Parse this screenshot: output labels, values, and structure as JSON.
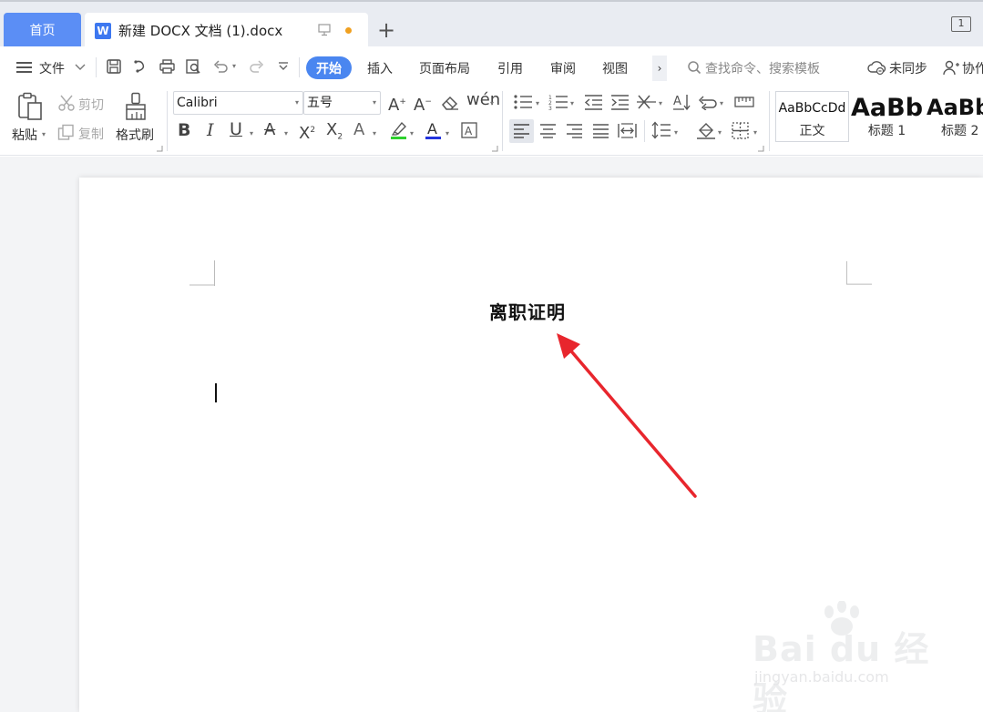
{
  "tabs": {
    "home": "首页",
    "doc_title": "新建 DOCX 文档 (1).docx",
    "add": "+",
    "window_index": "1"
  },
  "menu": {
    "file": "文件",
    "items": [
      "开始",
      "插入",
      "页面布局",
      "引用",
      "审阅",
      "视图"
    ],
    "more": "›",
    "search_placeholder": "查找命令、搜索模板",
    "sync": "未同步",
    "collab": "协作"
  },
  "ribbon": {
    "paste": "粘贴",
    "cut": "剪切",
    "copy": "复制",
    "format_painter": "格式刷",
    "font_name": "Calibri",
    "font_size": "五号",
    "styles": [
      {
        "sample": "AaBbCcDd",
        "label": "正文"
      },
      {
        "sample": "AaBb",
        "label": "标题 1"
      },
      {
        "sample": "AaBb",
        "label": "标题 2"
      }
    ]
  },
  "document": {
    "heading": "离职证明"
  },
  "watermark": {
    "brand": "Bai du 经验",
    "url": "jingyan.baidu.com"
  },
  "colors": {
    "accent": "#4a86f0",
    "home_tab": "#5b8ef5",
    "arrow": "#e8262d",
    "highlight_bar": "#2fd12f",
    "font_color_bar": "#2233dd"
  }
}
